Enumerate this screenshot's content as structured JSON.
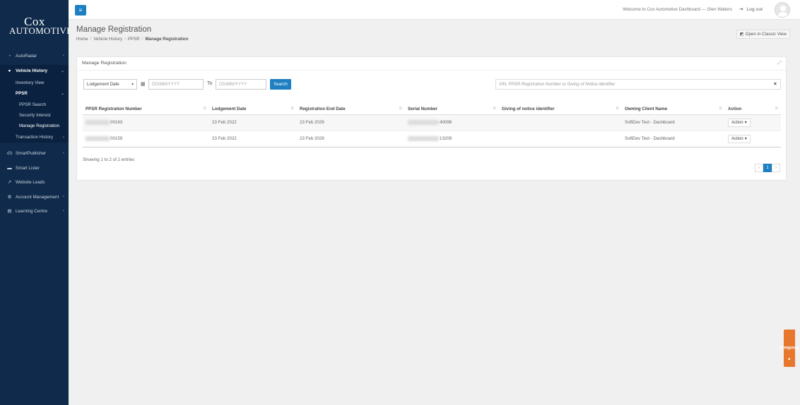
{
  "sidebar": {
    "logo_line1": "Cox",
    "logo_line2": "Automotive",
    "items": [
      {
        "label": "AutoRadar"
      },
      {
        "label": "Vehicle History"
      },
      {
        "label": "Inventory View"
      },
      {
        "label": "PPSR"
      },
      {
        "label": "PPSR Search"
      },
      {
        "label": "Security Interest"
      },
      {
        "label": "Manage Registration"
      },
      {
        "label": "Transaction History"
      },
      {
        "label": "SmartPublisher"
      },
      {
        "label": "Smart Lister"
      },
      {
        "label": "Website Leads"
      },
      {
        "label": "Account Management"
      },
      {
        "label": "Learning Centre"
      }
    ]
  },
  "topbar": {
    "welcome": "Welcome to Cox Automotive Dashboard — Glen Walters",
    "logout": "Log out"
  },
  "header": {
    "title": "Manage Registration",
    "breadcrumb": [
      "Home",
      "Vehicle History",
      "PPSR",
      "Manage Registration"
    ],
    "classic_view": "Open in Classic View"
  },
  "panel": {
    "title": "Manage Registration",
    "filter": {
      "date_type": "Lodgement Date",
      "from_placeholder": "DD/MM/YYYY",
      "to_label": "To",
      "to_placeholder": "DD/MM/YYYY",
      "search_label": "Search",
      "global_placeholder": "VIN, PPSR Registration Number or Giving of Notice identifier"
    },
    "table": {
      "columns": [
        "PPSR Registration Number",
        "Lodgement Date",
        "Registration End Date",
        "Serial Number",
        "Giving of notice identifier",
        "Owning Client Name",
        "Action"
      ],
      "rows": [
        {
          "reg": "00163",
          "lodgement": "23 Feb 2022",
          "end": "23 Feb 2029",
          "serial": "40098",
          "notice": "",
          "client": "SoftDev Test - Dashboard",
          "action": "Action"
        },
        {
          "reg": "00159",
          "lodgement": "23 Feb 2022",
          "end": "23 Feb 2029",
          "serial": "13209",
          "notice": "",
          "client": "SoftDev Test - Dashboard",
          "action": "Action"
        }
      ]
    },
    "entries": "Showing 1 to 2 of 2 entries",
    "pager": {
      "prev": "‹",
      "page": "1",
      "next": "›"
    }
  },
  "feedback": "Feedback",
  "colors": {
    "sidebar": "#0f2a4a",
    "accent": "#1f7fc3",
    "feedback": "#e8772e"
  },
  "icons": [
    "menu-icon",
    "logout-icon",
    "calendar-icon",
    "clear-icon",
    "expand-icon",
    "sort-icon",
    "comment-icon"
  ]
}
